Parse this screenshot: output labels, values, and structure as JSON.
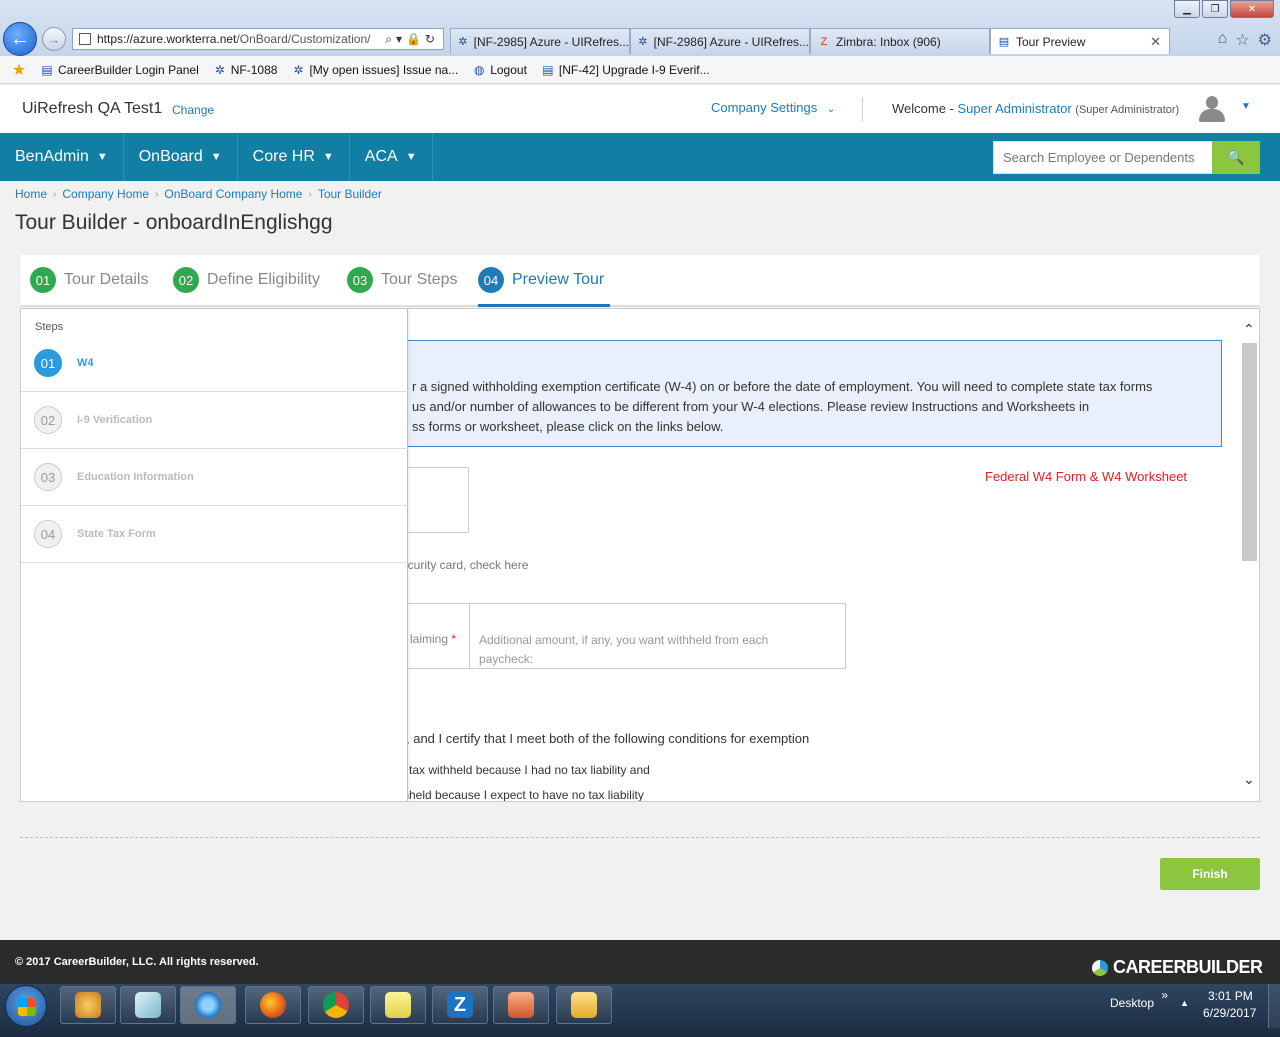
{
  "browser": {
    "window_controls": {
      "minimize": "▁",
      "restore": "❐",
      "close": "✕"
    },
    "address": {
      "prefix": "https://azure.",
      "domain": "workterra.net",
      "path": "/OnBoard/Customization/",
      "controls": "⌕▾🔒↻"
    },
    "tabs": [
      {
        "label": "[NF-2985] Azure - UIRefres...",
        "icon": "jira-icon"
      },
      {
        "label": "[NF-2986] Azure - UIRefres...",
        "icon": "jira-icon"
      },
      {
        "label": "Zimbra: Inbox (906)",
        "icon": "zimbra-icon"
      },
      {
        "label": "Tour Preview",
        "icon": "page-icon"
      }
    ],
    "tab_close": "✕",
    "favorites": [
      {
        "label": "CareerBuilder Login Panel",
        "icon": "page-icon"
      },
      {
        "label": "NF-1088",
        "icon": "jira-icon"
      },
      {
        "label": "[My open issues] Issue na...",
        "icon": "jira-icon"
      },
      {
        "label": "Logout",
        "icon": "globe-icon"
      },
      {
        "label": "[NF-42] Upgrade I-9 Everif...",
        "icon": "page-icon"
      }
    ]
  },
  "header": {
    "company": "UiRefresh QA Test1",
    "change": "Change",
    "company_settings": "Company Settings",
    "welcome": "Welcome - ",
    "user_name": "Super Administrator",
    "user_role": "(Super Administrator)"
  },
  "nav": {
    "items": [
      "BenAdmin",
      "OnBoard",
      "Core HR",
      "ACA"
    ],
    "search_placeholder": "Search Employee or Dependents"
  },
  "breadcrumb": [
    "Home",
    "Company Home",
    "OnBoard Company Home",
    "Tour Builder"
  ],
  "page_title": "Tour Builder - onboardInEnglishgg",
  "wizard": [
    {
      "num": "01",
      "label": "Tour Details"
    },
    {
      "num": "02",
      "label": "Define Eligibility"
    },
    {
      "num": "03",
      "label": "Tour Steps"
    },
    {
      "num": "04",
      "label": "Preview Tour"
    }
  ],
  "preview": {
    "info_lines": [
      "r a signed withholding exemption certificate (W-4) on or before the date of employment. You will need to complete state tax forms",
      "us and/or number of allowances to be different from your W-4 elections. Please review Instructions and Worksheets in",
      "ss forms or worksheet, please click on the links below."
    ],
    "w4_link": "Federal W4 Form & W4 Worksheet",
    "ssn_text": "ecurity card, check here",
    "claiming": "laiming",
    "required_mark": "*",
    "additional": "Additional amount, if any, you want withheld from each paycheck:",
    "exempt_text": ", and I certify that I meet both of the following conditions for exemption",
    "cond1": "e tax withheld because I had no tax liability and",
    "cond2": "thheld because I expect to have no tax liability",
    "scroll_up": "⌃",
    "scroll_down": "⌄"
  },
  "steps": {
    "label": "Steps",
    "items": [
      {
        "num": "01",
        "label": "W4"
      },
      {
        "num": "02",
        "label": "I-9 Verification"
      },
      {
        "num": "03",
        "label": "Education Information"
      },
      {
        "num": "04",
        "label": "State Tax Form"
      }
    ]
  },
  "finish": "Finish",
  "footer": {
    "copyright": "© 2017 CareerBuilder, LLC. All rights reserved.",
    "logo": "CAREERBUILDER"
  },
  "taskbar": {
    "desktop": "Desktop",
    "expand": "»",
    "time": "3:01 PM",
    "date": "6/29/2017"
  },
  "colors": {
    "nav_bg": "#117fa3",
    "link": "#1e7bb6",
    "step_done": "#2fa84f",
    "accent_green": "#8cc63f",
    "w4_link": "#e02020"
  }
}
